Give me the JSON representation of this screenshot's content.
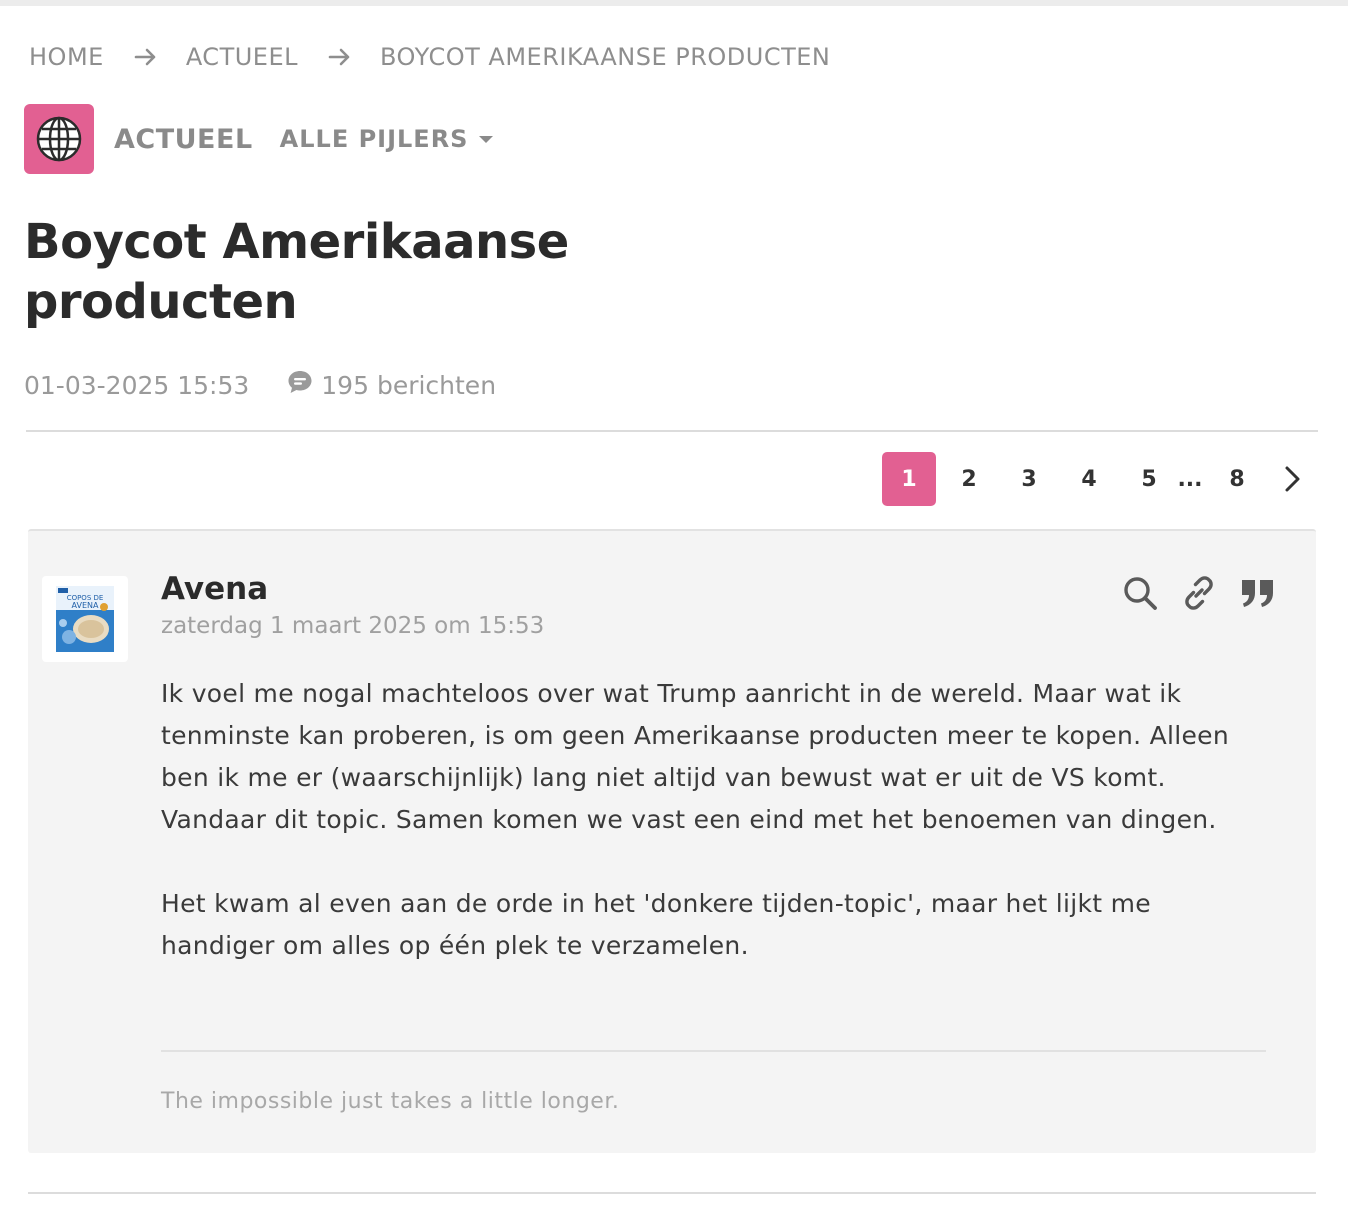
{
  "breadcrumb": {
    "items": [
      "HOME",
      "ACTUEEL",
      "BOYCOT AMERIKAANSE PRODUCTEN"
    ]
  },
  "category": {
    "icon": "globe-icon",
    "icon_color": "#e26092",
    "label": "ACTUEEL",
    "dropdown_label": "ALLE PIJLERS"
  },
  "topic": {
    "title": "Boycot Amerikaanse producten",
    "date": "01-03-2025 15:53",
    "comments": "195 berichten"
  },
  "pagination": {
    "pages": [
      "1",
      "2",
      "3",
      "4",
      "5"
    ],
    "ellipsis": "...",
    "last_page": "8",
    "current": "1",
    "accent_color": "#e26092"
  },
  "post": {
    "author": "Avena",
    "date": "zaterdag 1 maart 2025 om 15:53",
    "avatar_text": {
      "line1": "COPOS DE",
      "line2": "AVENA"
    },
    "body": [
      "Ik voel me nogal machteloos over wat Trump aanricht in de wereld. Maar wat ik tenminste kan proberen, is om geen Amerikaanse producten meer te kopen. Alleen ben ik me er (waarschijnlijk) lang niet altijd van bewust wat er uit de VS komt. Vandaar dit topic. Samen komen we vast een eind met het benoemen van dingen.",
      "Het kwam al even aan de orde in het 'donkere tijden-topic', maar het lijkt me handiger om alles op één plek te verzamelen."
    ],
    "signature": "The impossible just takes a little longer.",
    "actions": [
      "search-icon",
      "link-icon",
      "quote-icon"
    ]
  }
}
